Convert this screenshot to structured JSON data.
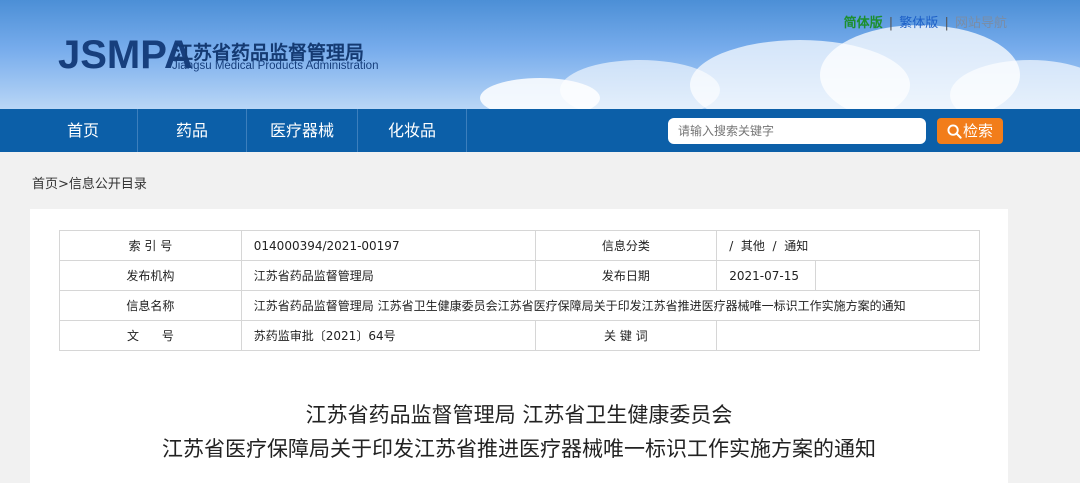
{
  "header": {
    "logo_mark": "JSMPA",
    "logo_cn": "江苏省药品监督管理局",
    "logo_en": "Jiangsu Medical Products Administration",
    "version_links": [
      "简体版",
      "繁体版",
      "网站导航"
    ],
    "separator": "|"
  },
  "nav": {
    "items": [
      "首页",
      "药品",
      "医疗器械",
      "化妆品"
    ],
    "search_placeholder": "请输入搜索关键字",
    "search_button": "检索"
  },
  "breadcrumb": "首页>信息公开目录",
  "meta_table": {
    "rows": [
      {
        "label1": "索 引 号",
        "value1": "014000394/2021-00197",
        "label2": "信息分类",
        "value2": "/  其他  /  通知"
      },
      {
        "label1": "发布机构",
        "value1": "江苏省药品监督管理局",
        "label2": "发布日期",
        "value2": "2021-07-15"
      },
      {
        "label1": "信息名称",
        "value1": "江苏省药品监督管理局 江苏省卫生健康委员会江苏省医疗保障局关于印发江苏省推进医疗器械唯一标识工作实施方案的通知"
      },
      {
        "label1": "文      号",
        "value1": "苏药监审批〔2021〕64号",
        "label2": "关 键 词",
        "value2": ""
      }
    ]
  },
  "article": {
    "title_line1": "江苏省药品监督管理局 江苏省卫生健康委员会",
    "title_line2": "江苏省医疗保障局关于印发江苏省推进医疗器械唯一标识工作实施方案的通知"
  },
  "colors": {
    "nav_bg": "#0c5fa8",
    "search_button": "#f27d1a",
    "simplified_link": "#1c8f2e",
    "traditional_link": "#1c5fc7"
  }
}
